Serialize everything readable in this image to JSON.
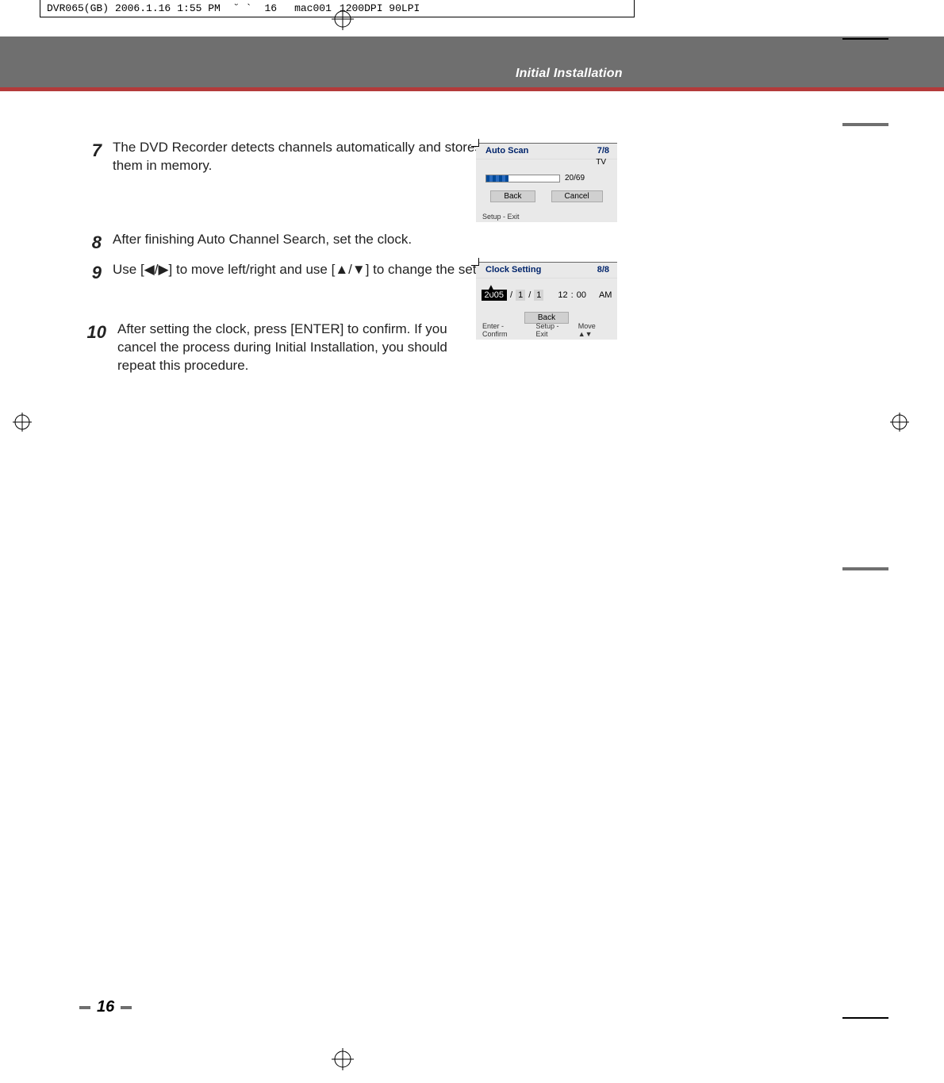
{
  "print_header": {
    "file": "DVR065(GB)",
    "date": "2006.1.16",
    "time": "1:55 PM",
    "tilde1": "˘",
    "tilde2": "`",
    "page": "16",
    "device": "mac001",
    "res": "1200DPI 90LPI"
  },
  "section_title": "Initial Installation",
  "steps": {
    "s7": {
      "num": "7",
      "text": "The DVD Recorder detects channels automatically and stores them in memory."
    },
    "s8": {
      "num": "8",
      "text": "After finishing Auto Channel Search, set the clock."
    },
    "s9": {
      "num": "9",
      "text": "Use [◀/▶] to move left/right and use [▲/▼] to change the settings."
    },
    "s10": {
      "num": "10",
      "text": "After setting the clock, press [ENTER] to confirm. If you cancel the process during Initial Installation, you should repeat this procedure."
    }
  },
  "autoscan": {
    "title": "Auto Scan",
    "step": "7/8",
    "tv": "TV",
    "progress": "20/69",
    "back": "Back",
    "cancel": "Cancel",
    "footer": "Setup - Exit"
  },
  "clock": {
    "title": "Clock Setting",
    "step": "8/8",
    "year": "2005",
    "slash": "/",
    "month": "1",
    "day": "1",
    "hour": "12",
    "colon": ":",
    "min": "00",
    "ampm": "AM",
    "back": "Back",
    "footer_enter": "Enter - Confirm",
    "footer_setup": "Setup - Exit",
    "footer_move": "Move ▲▼"
  },
  "page_number": "16"
}
